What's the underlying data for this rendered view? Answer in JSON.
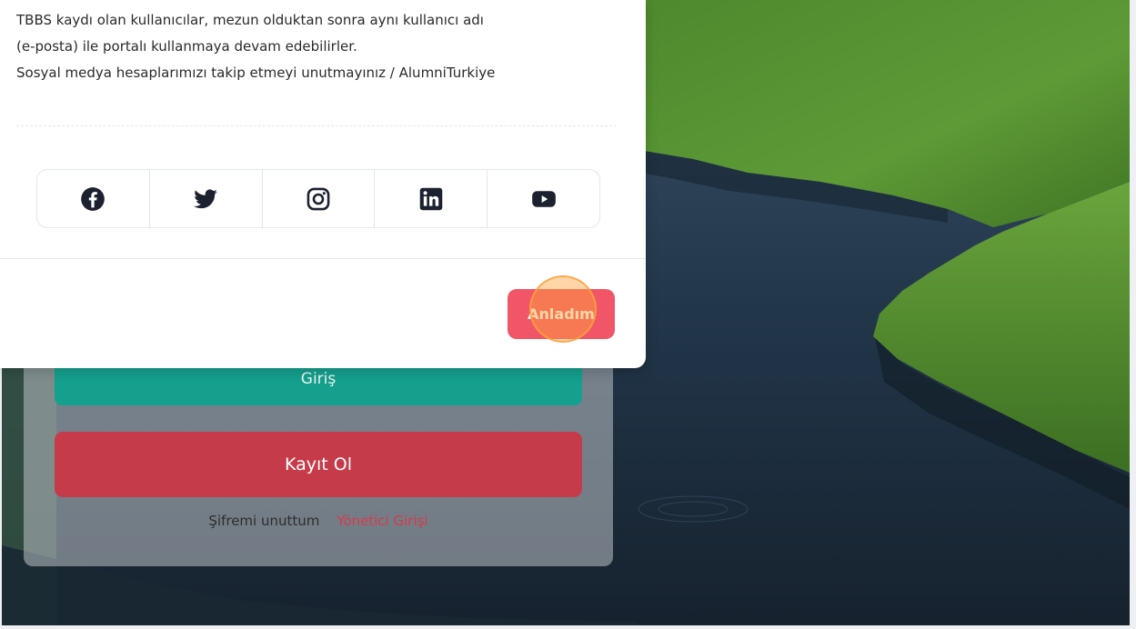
{
  "modal": {
    "lines": [
      "TBBS kaydı olan kullanıcılar, mezun olduktan sonra aynı kullanıcı adı",
      "(e-posta) ile portalı kullanmaya devam edebilirler.",
      "Sosyal medya hesaplarımızı takip etmeyi unutmayınız / AlumniTurkiye"
    ],
    "social": [
      {
        "icon": "facebook-icon"
      },
      {
        "icon": "twitter-icon"
      },
      {
        "icon": "instagram-icon"
      },
      {
        "icon": "linkedin-icon"
      },
      {
        "icon": "youtube-icon"
      }
    ],
    "ok_label": "Anladım"
  },
  "login": {
    "login_label": "Giriş",
    "register_label": "Kayıt Ol",
    "forgot_label": "Şifremi unuttum",
    "admin_label": "Yönetici Girişi"
  },
  "colors": {
    "login_button": "#15a08e",
    "register_button": "#c63b4a",
    "ok_button": "#f05667",
    "admin_link": "#d9394b"
  }
}
